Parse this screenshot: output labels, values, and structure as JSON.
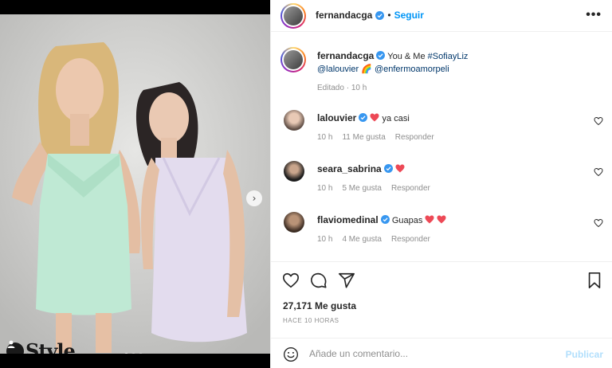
{
  "post": {
    "author": "fernandacga",
    "follow_label": "Seguir",
    "dot": "•",
    "more": "•••",
    "caption_prefix": "You & Me ",
    "caption_hashtag": "#SofiayLiz",
    "caption_mention1": "@lalouvier",
    "caption_emoji": "🌈",
    "caption_mention2": "@enfermoamorpeli",
    "edited_label": "Editado",
    "edited_sep": "·",
    "edited_time": "10 h",
    "watermark": "Style",
    "next_glyph": "›"
  },
  "comments": [
    {
      "user": "lalouvier",
      "text": "ya casi",
      "time": "10 h",
      "likes": "11 Me gusta",
      "reply": "Responder"
    },
    {
      "user": "seara_sabrina",
      "text": "",
      "time": "10 h",
      "likes": "5 Me gusta",
      "reply": "Responder"
    },
    {
      "user": "flaviomedinal",
      "text": "Guapas",
      "time": "10 h",
      "likes": "4 Me gusta",
      "reply": "Responder"
    }
  ],
  "stats": {
    "likes_label": "27,171 Me gusta",
    "time_ago": "HACE 10 HORAS"
  },
  "composer": {
    "placeholder": "Añade un comentario...",
    "publish_label": "Publicar"
  },
  "icons": {
    "verified": "verified-badge-icon",
    "heart": "heart-icon",
    "comment": "comment-icon",
    "share": "share-icon",
    "save": "bookmark-icon",
    "emoji": "emoji-icon",
    "red_heart": "red-heart-icon"
  },
  "colors": {
    "accent": "#0095f6",
    "link": "#00376b",
    "muted": "#8e8e8e",
    "heart_red": "#ed4956",
    "publish_disabled": "#b2dffc"
  }
}
